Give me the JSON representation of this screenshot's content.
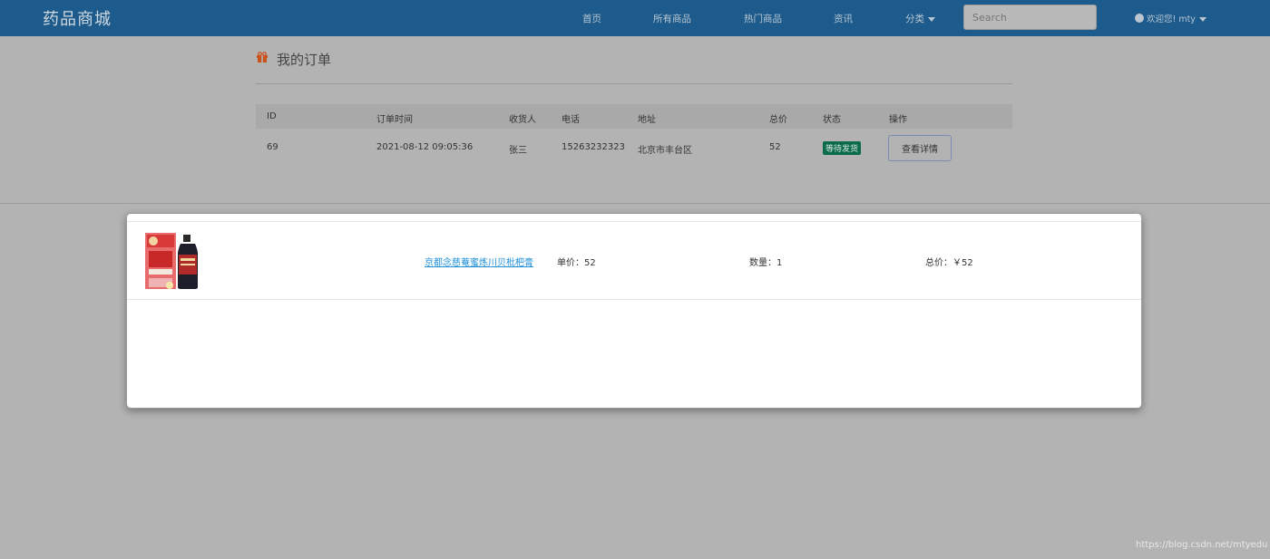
{
  "navbar": {
    "brand": "药品商城",
    "links": [
      "首页",
      "所有商品",
      "热门商品",
      "资讯",
      "分类"
    ],
    "search_placeholder": "Search",
    "user_greeting": "欢迎您! mty"
  },
  "page": {
    "title": "我的订单"
  },
  "orders": {
    "headers": [
      "ID",
      "订单时间",
      "收货人",
      "电话",
      "地址",
      "总价",
      "状态",
      "操作"
    ],
    "rows": [
      {
        "id": "69",
        "time": "2021-08-12 09:05:36",
        "receiver": "张三",
        "phone": "15263232323",
        "address": "北京市丰台区",
        "total": "52",
        "status": "等待发货",
        "action": "查看详情"
      }
    ]
  },
  "modal": {
    "item": {
      "name": "京都念慈菴蜜炼川贝枇杷膏",
      "unit_price": "单价：52",
      "quantity": "数量：1",
      "subtotal": "总价：￥52"
    }
  },
  "watermark": "https://blog.csdn.net/mtyedu",
  "colors": {
    "navbar": "#1d5b8c",
    "status_badge": "#0d6b4d",
    "link": "#1e8fd6",
    "gift_icon": "#c9531e"
  }
}
